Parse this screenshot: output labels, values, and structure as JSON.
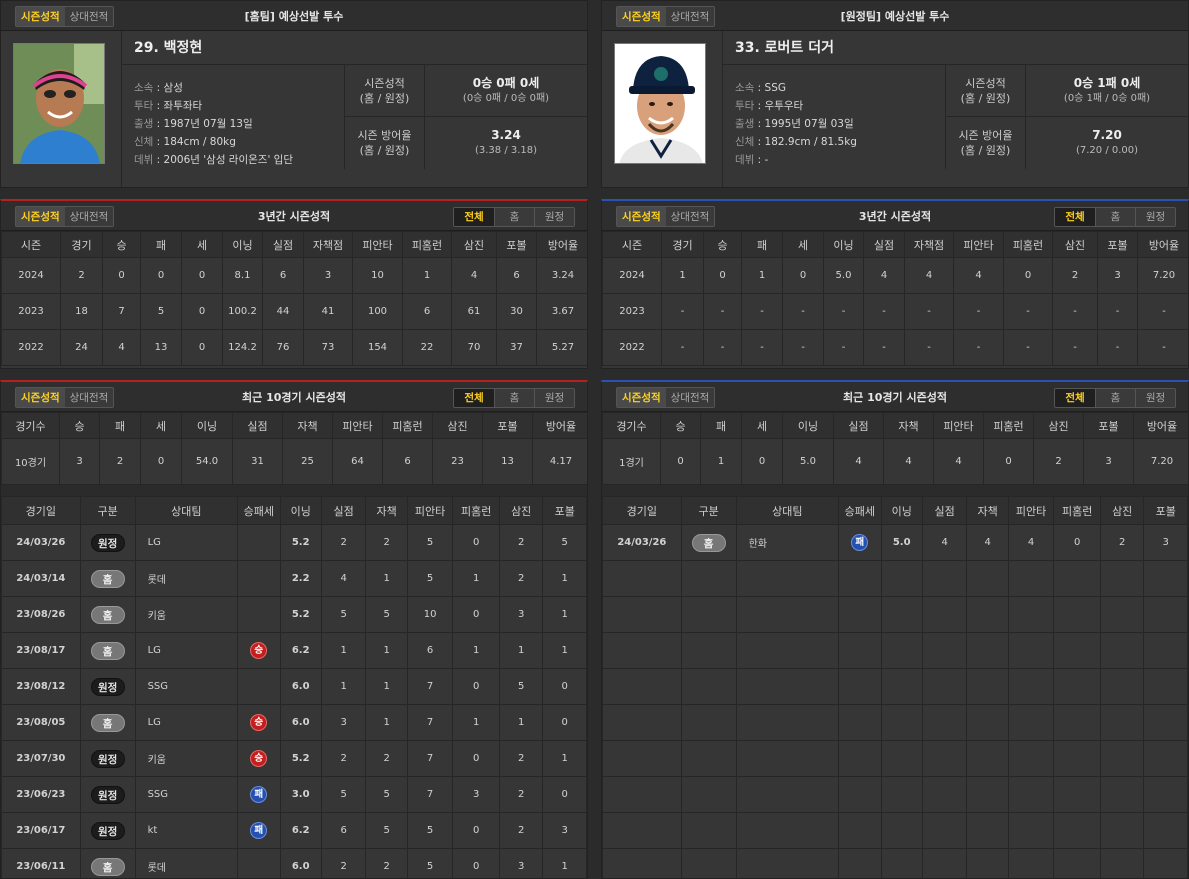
{
  "home": {
    "header": {
      "tab_season": "시즌성적",
      "tab_vs": "상대전적",
      "title": "[홈팀] 예상선발 투수"
    },
    "player": {
      "name": "29. 백정현",
      "info": [
        {
          "k": "소속",
          "v": "삼성"
        },
        {
          "k": "투타",
          "v": "좌투좌타"
        },
        {
          "k": "출생",
          "v": "1987년 07월 13일"
        },
        {
          "k": "신체",
          "v": "184cm / 80kg"
        },
        {
          "k": "데뷔",
          "v": "2006년 '삼성 라이온즈' 입단"
        }
      ],
      "record_label1": "시즌성적",
      "record_label2": "(홈 / 원정)",
      "record_main": "0승 0패 0세",
      "record_sub": "(0승 0패 / 0승 0패)",
      "era_label1": "시즌 방어율",
      "era_label2": "(홈 / 원정)",
      "era_main": "3.24",
      "era_sub": "(3.38 / 3.18)"
    },
    "season3": {
      "title": "3년간 시즌성적",
      "filters": [
        "전체",
        "홈",
        "원정"
      ],
      "headers": [
        "시즌",
        "경기",
        "승",
        "패",
        "세",
        "이닝",
        "실점",
        "자책점",
        "피안타",
        "피홈런",
        "삼진",
        "포볼",
        "방어율"
      ],
      "rows": [
        [
          "2024",
          "2",
          "0",
          "0",
          "0",
          "8.1",
          "6",
          "3",
          "10",
          "1",
          "4",
          "6",
          "3.24"
        ],
        [
          "2023",
          "18",
          "7",
          "5",
          "0",
          "100.2",
          "44",
          "41",
          "100",
          "6",
          "61",
          "30",
          "3.67"
        ],
        [
          "2022",
          "24",
          "4",
          "13",
          "0",
          "124.2",
          "76",
          "73",
          "154",
          "22",
          "70",
          "37",
          "5.27"
        ]
      ]
    },
    "recent": {
      "title": "최근 10경기 시즌성적",
      "filters": [
        "전체",
        "홈",
        "원정"
      ],
      "sum_headers": [
        "경기수",
        "승",
        "패",
        "세",
        "이닝",
        "실점",
        "자책",
        "피안타",
        "피홈런",
        "삼진",
        "포볼",
        "방어율"
      ],
      "sum_row": [
        "10경기",
        "3",
        "2",
        "0",
        "54.0",
        "31",
        "25",
        "64",
        "6",
        "23",
        "13",
        "4.17"
      ],
      "log_headers": [
        "경기일",
        "구분",
        "상대팀",
        "승패세",
        "이닝",
        "실점",
        "자책",
        "피안타",
        "피홈런",
        "삼진",
        "포볼"
      ],
      "log": [
        {
          "date": "24/03/26",
          "type": "원정",
          "kind": "away",
          "opp": "LG",
          "res": "",
          "rk": "",
          "ip": "5.2",
          "r": "2",
          "er": "2",
          "h": "5",
          "hr": "0",
          "so": "2",
          "bb": "5"
        },
        {
          "date": "24/03/14",
          "type": "홈",
          "kind": "home",
          "opp": "롯데",
          "res": "",
          "rk": "",
          "ip": "2.2",
          "r": "4",
          "er": "1",
          "h": "5",
          "hr": "1",
          "so": "2",
          "bb": "1"
        },
        {
          "date": "23/08/26",
          "type": "홈",
          "kind": "home",
          "opp": "키움",
          "res": "",
          "rk": "",
          "ip": "5.2",
          "r": "5",
          "er": "5",
          "h": "10",
          "hr": "0",
          "so": "3",
          "bb": "1"
        },
        {
          "date": "23/08/17",
          "type": "홈",
          "kind": "home",
          "opp": "LG",
          "res": "승",
          "rk": "win",
          "ip": "6.2",
          "r": "1",
          "er": "1",
          "h": "6",
          "hr": "1",
          "so": "1",
          "bb": "1"
        },
        {
          "date": "23/08/12",
          "type": "원정",
          "kind": "away",
          "opp": "SSG",
          "res": "",
          "rk": "",
          "ip": "6.0",
          "r": "1",
          "er": "1",
          "h": "7",
          "hr": "0",
          "so": "5",
          "bb": "0"
        },
        {
          "date": "23/08/05",
          "type": "홈",
          "kind": "home",
          "opp": "LG",
          "res": "승",
          "rk": "win",
          "ip": "6.0",
          "r": "3",
          "er": "1",
          "h": "7",
          "hr": "1",
          "so": "1",
          "bb": "0"
        },
        {
          "date": "23/07/30",
          "type": "원정",
          "kind": "away",
          "opp": "키움",
          "res": "승",
          "rk": "win",
          "ip": "5.2",
          "r": "2",
          "er": "2",
          "h": "7",
          "hr": "0",
          "so": "2",
          "bb": "1"
        },
        {
          "date": "23/06/23",
          "type": "원정",
          "kind": "away",
          "opp": "SSG",
          "res": "패",
          "rk": "loss",
          "ip": "3.0",
          "r": "5",
          "er": "5",
          "h": "7",
          "hr": "3",
          "so": "2",
          "bb": "0"
        },
        {
          "date": "23/06/17",
          "type": "원정",
          "kind": "away",
          "opp": "kt",
          "res": "패",
          "rk": "loss",
          "ip": "6.2",
          "r": "6",
          "er": "5",
          "h": "5",
          "hr": "0",
          "so": "2",
          "bb": "3"
        },
        {
          "date": "23/06/11",
          "type": "홈",
          "kind": "home",
          "opp": "롯데",
          "res": "",
          "rk": "",
          "ip": "6.0",
          "r": "2",
          "er": "2",
          "h": "5",
          "hr": "0",
          "so": "3",
          "bb": "1"
        }
      ]
    }
  },
  "away": {
    "header": {
      "tab_season": "시즌성적",
      "tab_vs": "상대전적",
      "title": "[원정팀] 예상선발 투수"
    },
    "player": {
      "name": "33. 로버트 더거",
      "info": [
        {
          "k": "소속",
          "v": "SSG"
        },
        {
          "k": "투타",
          "v": "우투우타"
        },
        {
          "k": "출생",
          "v": "1995년 07월 03일"
        },
        {
          "k": "신체",
          "v": "182.9cm / 81.5kg"
        },
        {
          "k": "데뷔",
          "v": "-"
        }
      ],
      "record_label1": "시즌성적",
      "record_label2": "(홈 / 원정)",
      "record_main": "0승 1패 0세",
      "record_sub": "(0승 1패 / 0승 0패)",
      "era_label1": "시즌 방어율",
      "era_label2": "(홈 / 원정)",
      "era_main": "7.20",
      "era_sub": "(7.20 / 0.00)"
    },
    "season3": {
      "title": "3년간 시즌성적",
      "filters": [
        "전체",
        "홈",
        "원정"
      ],
      "headers": [
        "시즌",
        "경기",
        "승",
        "패",
        "세",
        "이닝",
        "실점",
        "자책점",
        "피안타",
        "피홈런",
        "삼진",
        "포볼",
        "방어율"
      ],
      "rows": [
        [
          "2024",
          "1",
          "0",
          "1",
          "0",
          "5.0",
          "4",
          "4",
          "4",
          "0",
          "2",
          "3",
          "7.20"
        ],
        [
          "2023",
          "-",
          "-",
          "-",
          "-",
          "-",
          "-",
          "-",
          "-",
          "-",
          "-",
          "-",
          "-"
        ],
        [
          "2022",
          "-",
          "-",
          "-",
          "-",
          "-",
          "-",
          "-",
          "-",
          "-",
          "-",
          "-",
          "-"
        ]
      ]
    },
    "recent": {
      "title": "최근 10경기 시즌성적",
      "filters": [
        "전체",
        "홈",
        "원정"
      ],
      "sum_headers": [
        "경기수",
        "승",
        "패",
        "세",
        "이닝",
        "실점",
        "자책",
        "피안타",
        "피홈런",
        "삼진",
        "포볼",
        "방어율"
      ],
      "sum_row": [
        "1경기",
        "0",
        "1",
        "0",
        "5.0",
        "4",
        "4",
        "4",
        "0",
        "2",
        "3",
        "7.20"
      ],
      "log_headers": [
        "경기일",
        "구분",
        "상대팀",
        "승패세",
        "이닝",
        "실점",
        "자책",
        "피안타",
        "피홈런",
        "삼진",
        "포볼"
      ],
      "log": [
        {
          "date": "24/03/26",
          "type": "홈",
          "kind": "home",
          "opp": "한화",
          "res": "패",
          "rk": "loss",
          "ip": "5.0",
          "r": "4",
          "er": "4",
          "h": "4",
          "hr": "0",
          "so": "2",
          "bb": "3"
        }
      ]
    }
  },
  "colors": {
    "win": "#c21f1f",
    "loss": "#2450b0",
    "accent": "#ffd21f",
    "home_line": "#b52020",
    "away_line": "#2a52b5"
  }
}
